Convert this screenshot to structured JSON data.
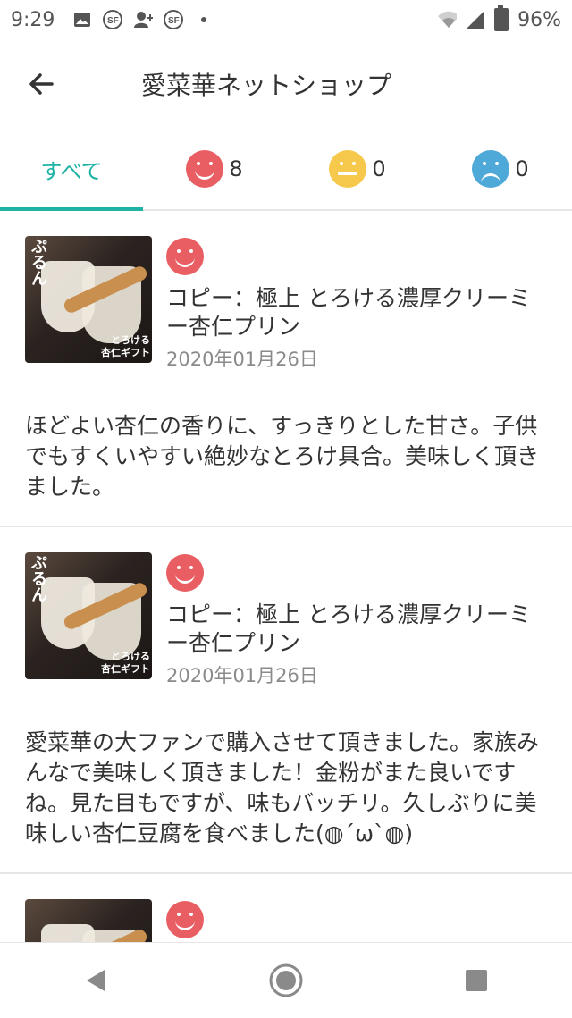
{
  "status_bar": {
    "time": "9:29",
    "battery": "96%",
    "icons": [
      "image-icon",
      "sf-icon",
      "add-user-icon",
      "sf-icon",
      "dot-icon",
      "wifi-icon",
      "signal-icon",
      "battery-icon"
    ]
  },
  "app_bar": {
    "title": "愛菜華ネットショップ"
  },
  "tabs": [
    {
      "label": "すべて",
      "active": true
    },
    {
      "icon": "smile-face-icon",
      "count": "8",
      "color": "#e85e62"
    },
    {
      "icon": "neutral-face-icon",
      "count": "0",
      "color": "#f6c84c"
    },
    {
      "icon": "sad-face-icon",
      "count": "0",
      "color": "#4fa9d8"
    }
  ],
  "reviews": [
    {
      "rating_icon": "smile-face-icon",
      "product": "コピー：極上 とろける濃厚クリーミー杏仁プリン",
      "date": "2020年01月26日",
      "comment": "ほどよい杏仁の香りに、すっきりとした甘さ。子供でもすくいやすい絶妙なとろけ具合。美味しく頂きました。"
    },
    {
      "rating_icon": "smile-face-icon",
      "product": "コピー：極上 とろける濃厚クリーミー杏仁プリン",
      "date": "2020年01月26日",
      "comment": "愛菜華の大ファンで購入させて頂きました。家族みんなで美味しく頂きました！金粉がまた良いですね。見た目もですが、味もバッチリ。久しぶりに美味しい杏仁豆腐を食べました(◍´ω`◍)"
    }
  ],
  "accent_color": "#1fb3a5",
  "nav": [
    "back-icon",
    "home-icon",
    "recents-icon"
  ]
}
